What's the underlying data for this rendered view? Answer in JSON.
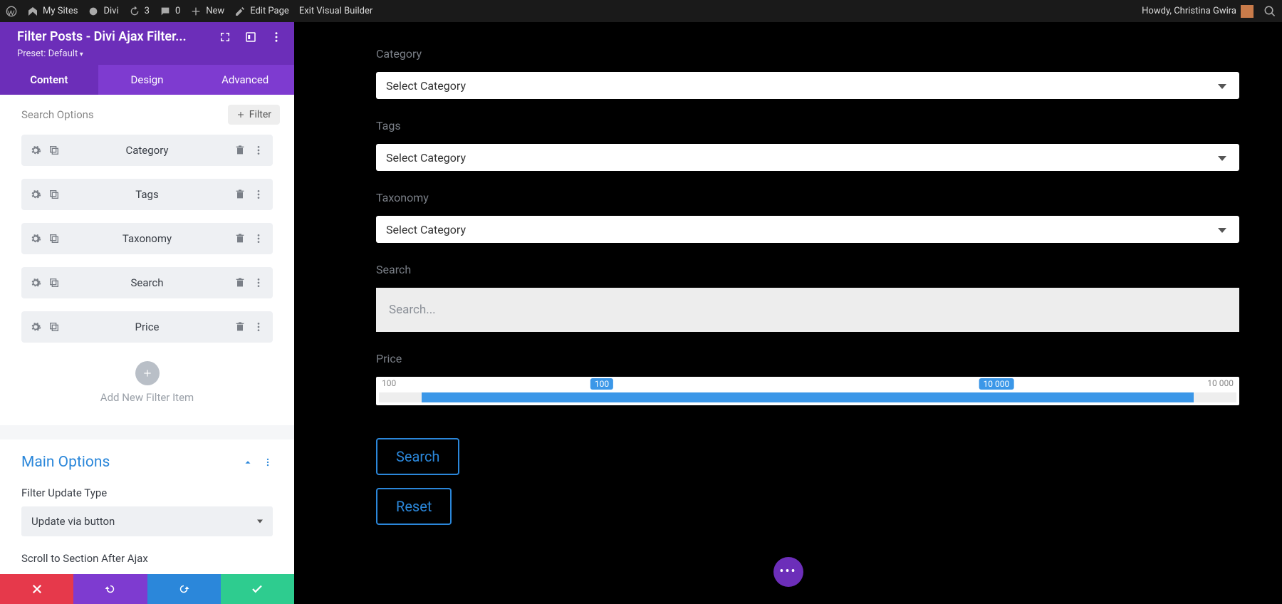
{
  "wpbar": {
    "mysites": "My Sites",
    "divi": "Divi",
    "refresh_count": "3",
    "comments_count": "0",
    "new": "New",
    "edit_page": "Edit Page",
    "exit_vb": "Exit Visual Builder",
    "howdy": "Howdy, Christina Gwira"
  },
  "sidebar": {
    "title": "Filter Posts - Divi Ajax Filter...",
    "preset": "Preset: Default",
    "tabs": {
      "content": "Content",
      "design": "Design",
      "advanced": "Advanced"
    },
    "search_options_label": "Search Options",
    "add_filter_label": "Filter",
    "items": [
      {
        "label": "Category"
      },
      {
        "label": "Tags"
      },
      {
        "label": "Taxonomy"
      },
      {
        "label": "Search"
      },
      {
        "label": "Price"
      }
    ],
    "add_new_label": "Add New Filter Item",
    "main_options_title": "Main Options",
    "filter_update_type_label": "Filter Update Type",
    "filter_update_type_value": "Update via button",
    "scroll_label": "Scroll to Section After Ajax"
  },
  "preview": {
    "category": {
      "label": "Category",
      "value": "Select Category"
    },
    "tags": {
      "label": "Tags",
      "value": "Select Category"
    },
    "taxonomy": {
      "label": "Taxonomy",
      "value": "Select Category"
    },
    "search": {
      "label": "Search",
      "placeholder": "Search..."
    },
    "price": {
      "label": "Price",
      "min": "100",
      "max": "10 000",
      "low_bubble": "100",
      "high_bubble": "10 000"
    },
    "search_button": "Search",
    "reset_button": "Reset"
  }
}
